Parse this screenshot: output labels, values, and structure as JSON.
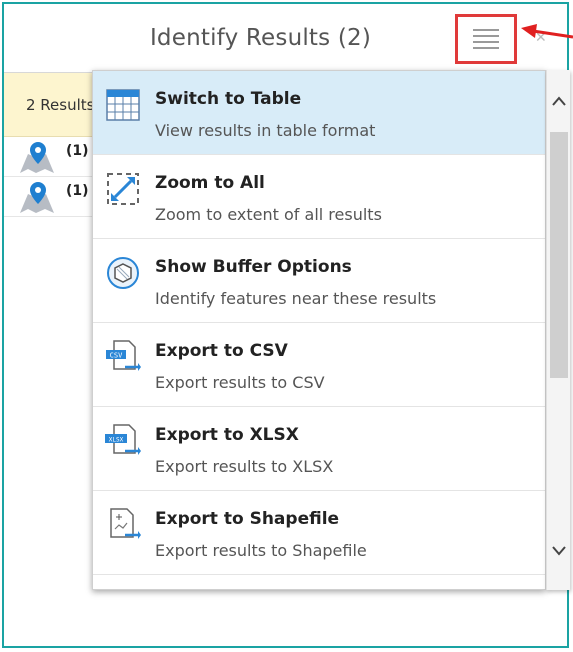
{
  "header": {
    "title": "Identify Results (2)"
  },
  "summary": {
    "text": "2 Results"
  },
  "results": [
    {
      "label": "(1)"
    },
    {
      "label": "(1)"
    }
  ],
  "menu": {
    "items": [
      {
        "label": "Switch to Table",
        "desc": "View results in table format",
        "icon": "table-icon"
      },
      {
        "label": "Zoom to All",
        "desc": "Zoom to extent of all results",
        "icon": "zoom-extent-icon"
      },
      {
        "label": "Show Buffer Options",
        "desc": "Identify features near these results",
        "icon": "buffer-icon"
      },
      {
        "label": "Export to CSV",
        "desc": "Export results to CSV",
        "icon": "csv-export-icon"
      },
      {
        "label": "Export to XLSX",
        "desc": "Export results to XLSX",
        "icon": "xlsx-export-icon"
      },
      {
        "label": "Export to Shapefile",
        "desc": "Export results to Shapefile",
        "icon": "shapefile-export-icon"
      }
    ]
  },
  "icon_text": {
    "csv": "CSV",
    "xlsx": "XLSX"
  },
  "colors": {
    "frame": "#1aa3a3",
    "highlight": "#e03a3a",
    "active_item": "#d8ecf8",
    "summary_bg": "#fdf5cf",
    "accent": "#2a86d6"
  }
}
